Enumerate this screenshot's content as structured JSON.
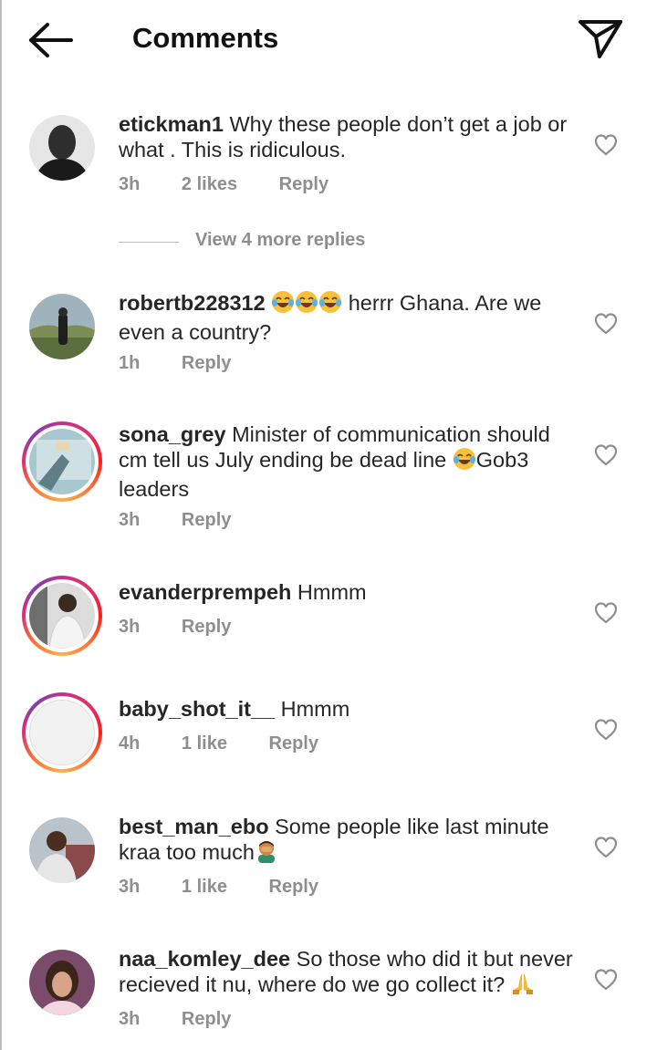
{
  "header": {
    "title": "Comments"
  },
  "thread_controls": {
    "view_more_label": "View 4 more replies"
  },
  "comments": [
    {
      "username": "etickman1",
      "text": "Why these people don’t get a job or what . This is ridiculous.",
      "time": "3h",
      "likes": "2 likes",
      "reply_label": "Reply"
    },
    {
      "username": "robertb228312",
      "text_after_emoji": "herrr Ghana. Are we even a country?",
      "emoji": [
        "face-with-tears-of-joy",
        "face-with-tears-of-joy",
        "face-with-tears-of-joy"
      ],
      "time": "1h",
      "reply_label": "Reply"
    },
    {
      "username": "sona_grey",
      "text_before_emoji": "Minister of communication should cm tell us July ending be dead line",
      "emoji": [
        "face-with-tears-of-joy"
      ],
      "text_after_emoji": "Gob3 leaders",
      "time": "3h",
      "reply_label": "Reply"
    },
    {
      "username": "evanderprempeh",
      "text": "Hmmm",
      "time": "3h",
      "reply_label": "Reply"
    },
    {
      "username": "baby_shot_it__",
      "text": "Hmmm",
      "time": "4h",
      "likes": "1 like",
      "reply_label": "Reply"
    },
    {
      "username": "best_man_ebo",
      "text": "Some people like last minute kraa too much",
      "emoji": [
        "man-facepalming"
      ],
      "time": "3h",
      "likes": "1 like",
      "reply_label": "Reply"
    },
    {
      "username": "naa_komley_dee",
      "text": "So those who did it but never recieved it nu, where do we go collect it?",
      "emoji": [
        "folded-hands"
      ],
      "time": "3h",
      "reply_label": "Reply"
    }
  ],
  "colors": {
    "text": "#262626",
    "meta": "#8e8e8e",
    "story_ring": "#e1306c"
  },
  "icons": {
    "back": "arrow-left-icon",
    "send": "paper-plane-icon",
    "like": "heart-outline-icon"
  }
}
